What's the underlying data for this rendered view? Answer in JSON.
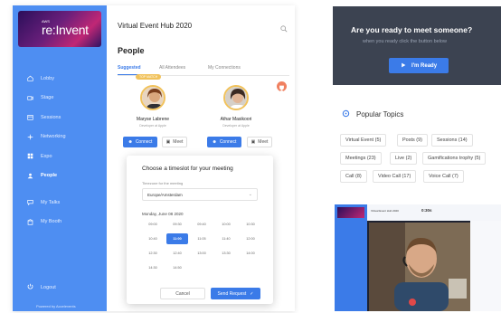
{
  "app": {
    "brand": {
      "aws": "AWS",
      "name": "re:Invent"
    },
    "sidebar": {
      "items": [
        {
          "label": "Lobby",
          "icon": "home-icon",
          "active": false
        },
        {
          "label": "Stage",
          "icon": "video-icon",
          "active": false
        },
        {
          "label": "Sessions",
          "icon": "calendar-icon",
          "active": false
        },
        {
          "label": "Networking",
          "icon": "network-icon",
          "active": false
        },
        {
          "label": "Expo",
          "icon": "grid-icon",
          "active": false
        },
        {
          "label": "People",
          "icon": "people-icon",
          "active": true
        }
      ],
      "items2": [
        {
          "label": "My Talks",
          "icon": "chat-icon"
        },
        {
          "label": "My Booth",
          "icon": "booth-icon"
        }
      ],
      "logout": "Logout",
      "powered": "Powered by Accelevents"
    },
    "header": {
      "title": "Virtual Event Hub 2020",
      "search_icon": "search-icon"
    },
    "people_title": "People",
    "tabs": [
      {
        "label": "Suggested",
        "active": true
      },
      {
        "label": "All Attendees",
        "active": false
      },
      {
        "label": "My Connections",
        "active": false
      }
    ],
    "badge": "TOP MATCH",
    "people": [
      {
        "name": "Maryse Labrene",
        "role": "Developer at Apple"
      },
      {
        "name": "Athar Masikoori",
        "role": "Developer at Apple"
      }
    ],
    "connect_label": "Connect",
    "meet_label": "Meet",
    "popup": {
      "title": "Choose a timeslot for your meeting",
      "tz_label": "Timezone for the meeting",
      "tz_value": "Europe/Amsterdam",
      "date_label": "Monday, June 08 2020",
      "slots": [
        "09:00",
        "09:30",
        "09:40",
        "10:00",
        "10:30",
        "10:40",
        "11:00",
        "11:05",
        "11:40",
        "12:00",
        "12:30",
        "12:40",
        "13:00",
        "13:30",
        "14:00",
        "14:30",
        "14:50"
      ],
      "selected_slot": "11:00",
      "cancel": "Cancel",
      "send": "Send Request"
    }
  },
  "ready_card": {
    "question": "Are you ready to meet someone?",
    "subtitle": "when you ready click the button below",
    "button": "I'm Ready"
  },
  "topics": {
    "title": "Popular Topics",
    "tags": [
      "Virtual Event (5)",
      "Posts (9)",
      "Sessions (14)",
      "Meetings (23)",
      "Live (2)",
      "Gamifications trophy (5)",
      "Call (8)",
      "Video Call (17)",
      "Voice Call (7)"
    ]
  },
  "video": {
    "title": "Virtual Event Hub 2020",
    "timer": "0:30s"
  },
  "colors": {
    "accent": "#3b7be8",
    "sidebar": "#4e8ef2",
    "dark_card": "#3c4351",
    "gold": "#f1c25b"
  }
}
